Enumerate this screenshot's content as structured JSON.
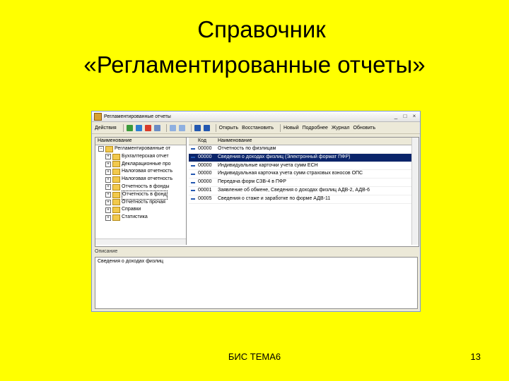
{
  "slide": {
    "title_line1": "Справочник",
    "title_line2": "«Регламентированные отчеты»",
    "footer_center": "БИС ТЕМА6",
    "page_number": "13"
  },
  "window": {
    "title": "Регламентированные отчеты",
    "buttons": {
      "minimize": "_",
      "maximize": "□",
      "close": "×"
    }
  },
  "toolbar": {
    "actions_label": "Действия",
    "sort_label": "Открыть",
    "restore_label": "Восстановить",
    "new_label": "Новый",
    "more_label": "Подробнее",
    "journal_label": "Журнал",
    "update_label": "Обновить"
  },
  "tree": {
    "header": "Наименование",
    "items": [
      {
        "label": "Регламентированные от",
        "indent": 0,
        "selected": false
      },
      {
        "label": "Бухгалтерская отчет",
        "indent": 1,
        "selected": false
      },
      {
        "label": "Декларационные про",
        "indent": 1,
        "selected": false
      },
      {
        "label": "Налоговая отчетность",
        "indent": 1,
        "selected": false
      },
      {
        "label": "Налоговая отчетность",
        "indent": 1,
        "selected": false
      },
      {
        "label": "Отчетность в фонды",
        "indent": 1,
        "selected": false
      },
      {
        "label": "Отчетность в фонд",
        "indent": 1,
        "selected": true
      },
      {
        "label": "Отчетность прочая",
        "indent": 1,
        "selected": false
      },
      {
        "label": "Справки",
        "indent": 1,
        "selected": false
      },
      {
        "label": "Статистика",
        "indent": 1,
        "selected": false
      }
    ]
  },
  "list": {
    "header_code": "Код",
    "header_name": "Наименование",
    "rows": [
      {
        "code": "00000",
        "name": "Отчетность по физлицам",
        "selected": false
      },
      {
        "code": "00000",
        "name": "Сведения о доходах физлиц (Электронный формат ПФР)",
        "selected": true
      },
      {
        "code": "00000",
        "name": "Индивидуальные карточки учета сумм ЕСН",
        "selected": false
      },
      {
        "code": "00000",
        "name": "Индивидуальная карточка учета сумм страховых взносов ОПС",
        "selected": false
      },
      {
        "code": "00000",
        "name": "Передача форм СЗВ-4 в ПФР",
        "selected": false
      },
      {
        "code": "00001",
        "name": "Заявление об обмене, Сведения о доходах физлиц АДВ-2, АДВ-6",
        "selected": false
      },
      {
        "code": "00005",
        "name": "Сведения о стаже и заработке по форме АДВ-11",
        "selected": false
      }
    ]
  },
  "comment": {
    "label": "Описание",
    "text": "Сведения о доходах физлиц"
  }
}
